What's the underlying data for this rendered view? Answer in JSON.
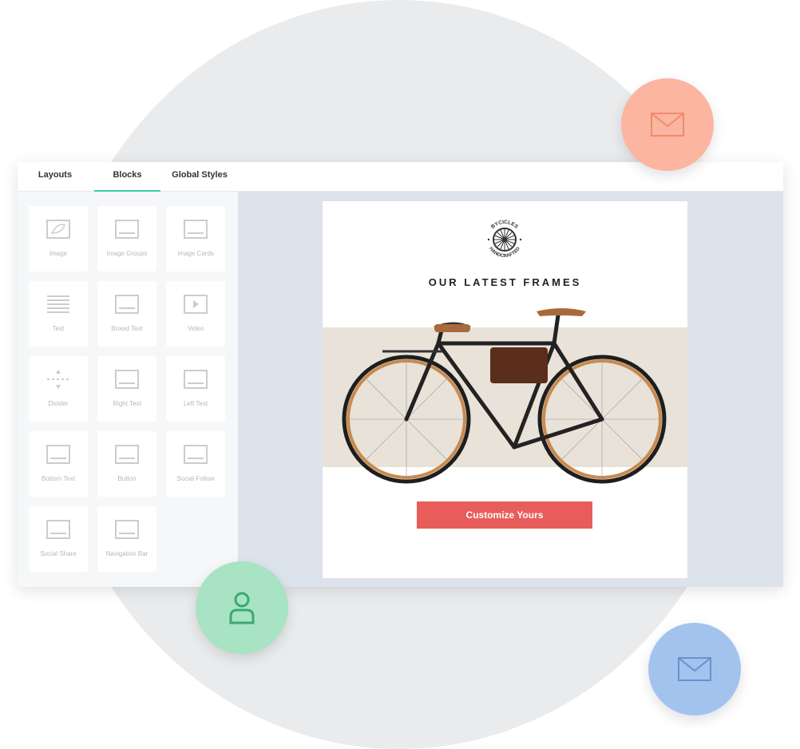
{
  "tabs": [
    {
      "label": "Layouts"
    },
    {
      "label": "Blocks",
      "active": true
    },
    {
      "label": "Global Styles"
    }
  ],
  "blocks": [
    {
      "label": "Image",
      "icon": "image-icon"
    },
    {
      "label": "Image Groups",
      "icon": "image-groups-icon"
    },
    {
      "label": "Image Cards",
      "icon": "image-cards-icon"
    },
    {
      "label": "Text",
      "icon": "text-icon"
    },
    {
      "label": "Boxed Text",
      "icon": "boxed-text-icon"
    },
    {
      "label": "Video",
      "icon": "video-icon"
    },
    {
      "label": "Divider",
      "icon": "divider-icon"
    },
    {
      "label": "Right Text",
      "icon": "right-text-icon"
    },
    {
      "label": "Left Text",
      "icon": "left-text-icon"
    },
    {
      "label": "Bottom Text",
      "icon": "bottom-text-icon"
    },
    {
      "label": "Button",
      "icon": "button-icon"
    },
    {
      "label": "Social Follow",
      "icon": "social-follow-icon"
    },
    {
      "label": "Social Share",
      "icon": "social-share-icon"
    },
    {
      "label": "Navigation Bar",
      "icon": "navigation-bar-icon"
    }
  ],
  "email": {
    "logo_top": "BYCICLES",
    "logo_bottom": "HANDCRAFTED",
    "heading": "OUR LATEST FRAMES",
    "cta": "Customize Yours"
  },
  "colors": {
    "accent": "#3cc9a8",
    "cta": "#e85d5a",
    "bubble_orange": "#fbb5a0",
    "bubble_green": "#a8e3c4",
    "bubble_blue": "#a3c3ef"
  },
  "bubbles": [
    {
      "icon": "envelope-icon"
    },
    {
      "icon": "user-icon"
    },
    {
      "icon": "envelope-icon"
    }
  ]
}
